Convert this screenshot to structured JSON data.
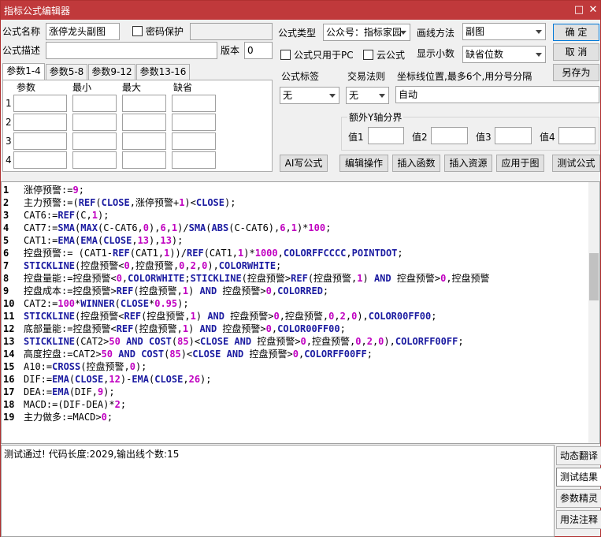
{
  "window": {
    "title": "指标公式编辑器",
    "min_btn": "□",
    "close_btn": "✕"
  },
  "form": {
    "name_label": "公式名称",
    "name_value": "涨停龙头副图",
    "password_label": "密码保护",
    "desc_label": "公式描述",
    "desc_value": "",
    "version_label": "版本",
    "version_value": "0",
    "type_label": "公式类型",
    "type_value": "公众号：指标家园",
    "draw_label": "画线方法",
    "draw_value": "副图",
    "pc_only_label": "公式只用于PC",
    "cloud_label": "云公式",
    "decimal_label": "显示小数",
    "decimal_value": "缺省位数",
    "tag_label": "公式标签",
    "tag_value": "无",
    "trade_label": "交易法则",
    "trade_value": "无",
    "coord_label": "坐标线位置,最多6个,用分号分隔",
    "coord_value": "自动",
    "extra_y_label": "额外Y轴分界",
    "val_labels": [
      "值1",
      "值2",
      "值3",
      "值4"
    ]
  },
  "buttons": {
    "ok": "确 定",
    "cancel": "取 消",
    "save_as": "另存为",
    "ai": "AI写公式",
    "edit_op": "编辑操作",
    "insert_func": "插入函数",
    "insert_res": "插入资源",
    "apply": "应用于图",
    "test": "测试公式"
  },
  "params": {
    "tabs": [
      "参数1-4",
      "参数5-8",
      "参数9-12",
      "参数13-16"
    ],
    "headers": [
      "参数",
      "最小",
      "最大",
      "缺省"
    ],
    "rows": [
      "1",
      "2",
      "3",
      "4"
    ]
  },
  "colors": {
    "keyword": "#1a1aa0",
    "number": "#c000c0",
    "color": "#808000",
    "teal": "#1a8aa0",
    "op": "#c00000"
  },
  "code": {
    "lines": [
      {
        "n": "1",
        "t": "涨停预警:=9;"
      },
      {
        "n": "2",
        "t": "主力预警:=(REF(CLOSE,涨停预警+1)<CLOSE);"
      },
      {
        "n": "3",
        "t": "CAT6:=REF(C,1);"
      },
      {
        "n": "4",
        "t": "CAT7:=SMA(MAX(C-CAT6,0),6,1)/SMA(ABS(C-CAT6),6,1)*100;"
      },
      {
        "n": "5",
        "t": "CAT1:=EMA(EMA(CLOSE,13),13);"
      },
      {
        "n": "6",
        "t": "控盘预警:= (CAT1-REF(CAT1,1))/REF(CAT1,1)*1000,COLORFFCCCC,POINTDOT;"
      },
      {
        "n": "7",
        "t": "STICKLINE(控盘预警<0,控盘预警,0,2,0),COLORWHITE;"
      },
      {
        "n": "8",
        "t": "控盘量能:=控盘预警<0,COLORWHITE;STICKLINE(控盘预警>REF(控盘预警,1) AND 控盘预警>0,控盘预警"
      },
      {
        "n": "9",
        "t": "控盘成本:=控盘预警>REF(控盘预警,1) AND 控盘预警>0,COLORRED;"
      },
      {
        "n": "10",
        "t": "CAT2:=100*WINNER(CLOSE*0.95);"
      },
      {
        "n": "11",
        "t": "STICKLINE(控盘预警<REF(控盘预警,1) AND 控盘预警>0,控盘预警,0,2,0),COLOR00FF00;"
      },
      {
        "n": "12",
        "t": "底部量能:=控盘预警<REF(控盘预警,1) AND 控盘预警>0,COLOR00FF00;"
      },
      {
        "n": "13",
        "t": "STICKLINE(CAT2>50 AND COST(85)<CLOSE AND 控盘预警>0,控盘预警,0,2,0),COLORFF00FF;"
      },
      {
        "n": "14",
        "t": "高度控盘:=CAT2>50 AND COST(85)<CLOSE AND 控盘预警>0,COLORFF00FF;"
      },
      {
        "n": "15",
        "t": "A10:=CROSS(控盘预警,0);"
      },
      {
        "n": "16",
        "t": "DIF:=EMA(CLOSE,12)-EMA(CLOSE,26);"
      },
      {
        "n": "17",
        "t": "DEA:=EMA(DIF,9);"
      },
      {
        "n": "18",
        "t": "MACD:=(DIF-DEA)*2;"
      },
      {
        "n": "19",
        "t": "主力做多:=MACD>0;"
      }
    ]
  },
  "output": {
    "text": "测试通过! 代码长度:2029,输出线个数:15"
  },
  "side": {
    "items": [
      "动态翻译",
      "测试结果",
      "参数精灵",
      "用法注释"
    ]
  }
}
